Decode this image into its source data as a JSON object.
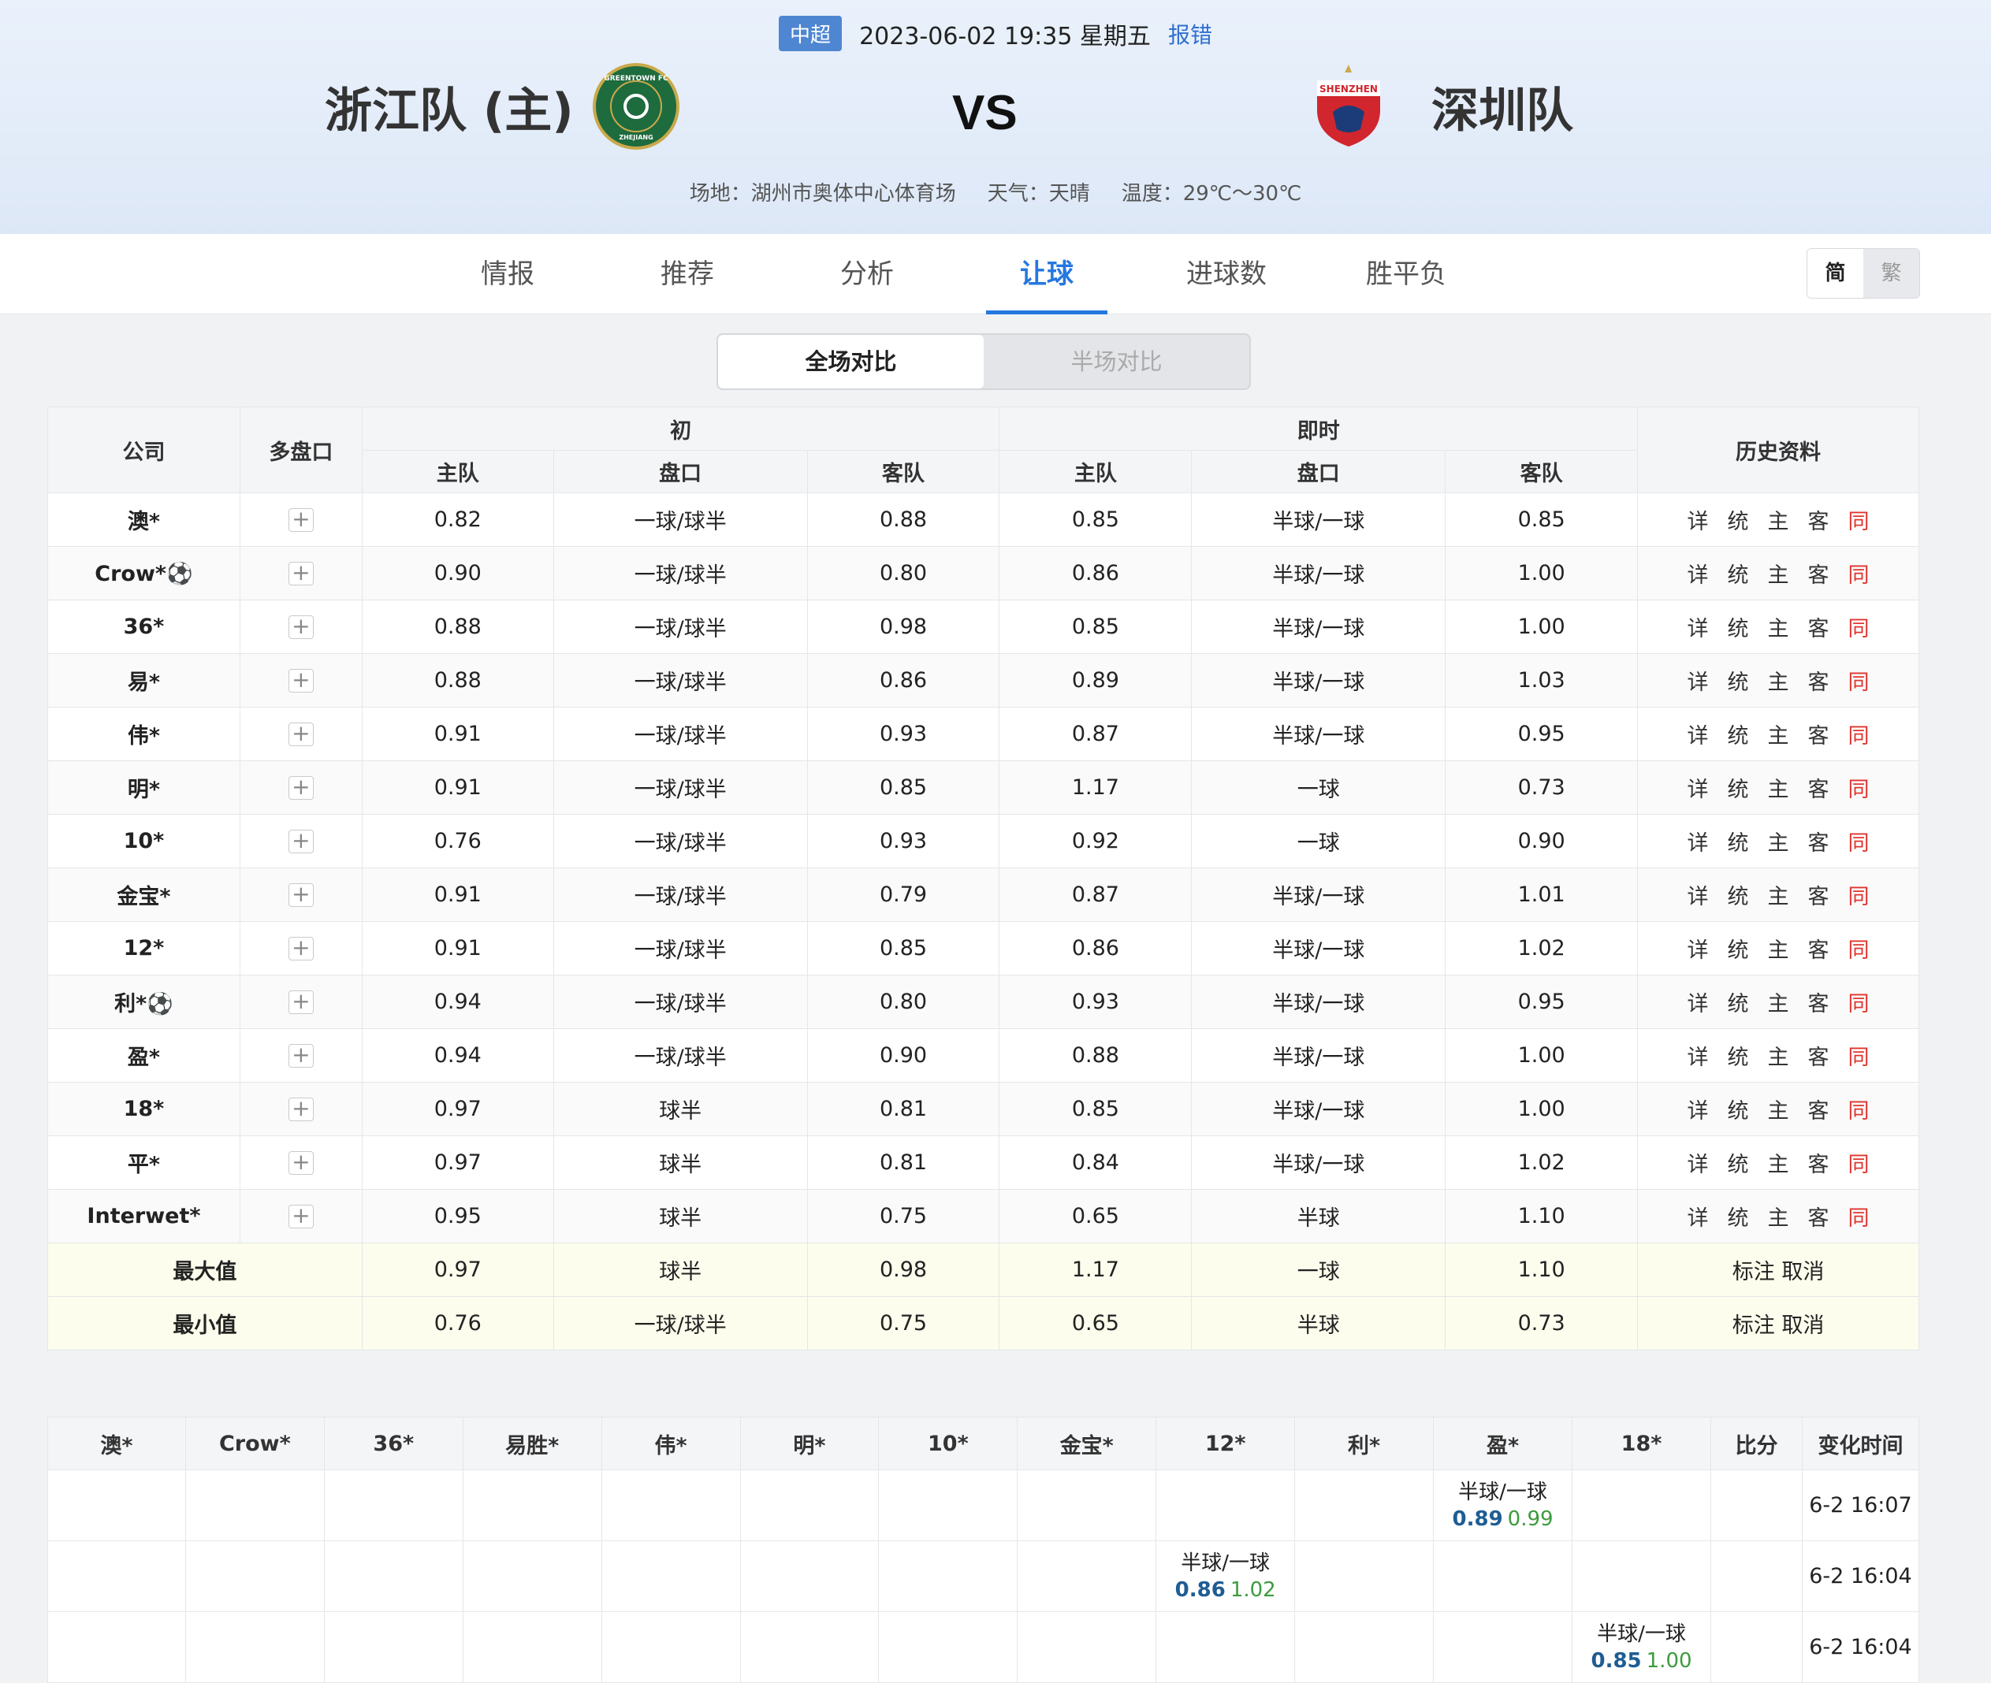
{
  "match": {
    "league": "中超",
    "datetime": "2023-06-02 19:35 星期五",
    "report": "报错",
    "home_team": "浙江队 (主)",
    "away_team": "深圳队",
    "vs": "VS",
    "venue": "场地：湖州市奥体中心体育场",
    "weather": "天气：天晴",
    "temperature": "温度：29℃～30℃",
    "home_crest_text": "GREENTOWN FC",
    "home_crest_sub": "ZHEJIANG",
    "away_crest_text": "SHENZHEN"
  },
  "nav": {
    "tabs": [
      "情报",
      "推荐",
      "分析",
      "让球",
      "进球数",
      "胜平负"
    ],
    "active": "让球",
    "lang_simplified": "简",
    "lang_traditional": "繁"
  },
  "segment": {
    "full": "全场对比",
    "half": "半场对比"
  },
  "odds_table": {
    "headers": {
      "company": "公司",
      "multi": "多盘口",
      "initial": "初",
      "live": "即时",
      "history": "历史资料",
      "home": "主队",
      "line": "盘口",
      "away": "客队"
    },
    "plus": "+",
    "history_links": [
      "详",
      "统",
      "主",
      "客",
      "同"
    ],
    "rows": [
      {
        "company": "澳*",
        "i_home": "0.82",
        "i_line": "一球/球半",
        "i_away": "0.88",
        "l_home": "0.85",
        "l_line": "半球/一球",
        "l_away": "0.85"
      },
      {
        "company": "Crow*⚽",
        "i_home": "0.90",
        "i_line": "一球/球半",
        "i_away": "0.80",
        "l_home": "0.86",
        "l_line": "半球/一球",
        "l_away": "1.00"
      },
      {
        "company": "36*",
        "i_home": "0.88",
        "i_line": "一球/球半",
        "i_away": "0.98",
        "l_home": "0.85",
        "l_line": "半球/一球",
        "l_away": "1.00"
      },
      {
        "company": "易*",
        "i_home": "0.88",
        "i_line": "一球/球半",
        "i_away": "0.86",
        "l_home": "0.89",
        "l_line": "半球/一球",
        "l_away": "1.03"
      },
      {
        "company": "伟*",
        "i_home": "0.91",
        "i_line": "一球/球半",
        "i_away": "0.93",
        "l_home": "0.87",
        "l_line": "半球/一球",
        "l_away": "0.95"
      },
      {
        "company": "明*",
        "i_home": "0.91",
        "i_line": "一球/球半",
        "i_away": "0.85",
        "l_home": "1.17",
        "l_line": "一球",
        "l_away": "0.73"
      },
      {
        "company": "10*",
        "i_home": "0.76",
        "i_line": "一球/球半",
        "i_away": "0.93",
        "l_home": "0.92",
        "l_line": "一球",
        "l_away": "0.90"
      },
      {
        "company": "金宝*",
        "i_home": "0.91",
        "i_line": "一球/球半",
        "i_away": "0.79",
        "l_home": "0.87",
        "l_line": "半球/一球",
        "l_away": "1.01"
      },
      {
        "company": "12*",
        "i_home": "0.91",
        "i_line": "一球/球半",
        "i_away": "0.85",
        "l_home": "0.86",
        "l_line": "半球/一球",
        "l_away": "1.02"
      },
      {
        "company": "利*⚽",
        "i_home": "0.94",
        "i_line": "一球/球半",
        "i_away": "0.80",
        "l_home": "0.93",
        "l_line": "半球/一球",
        "l_away": "0.95"
      },
      {
        "company": "盈*",
        "i_home": "0.94",
        "i_line": "一球/球半",
        "i_away": "0.90",
        "l_home": "0.88",
        "l_line": "半球/一球",
        "l_away": "1.00"
      },
      {
        "company": "18*",
        "i_home": "0.97",
        "i_line": "球半",
        "i_away": "0.81",
        "l_home": "0.85",
        "l_line": "半球/一球",
        "l_away": "1.00"
      },
      {
        "company": "平*",
        "i_home": "0.97",
        "i_line": "球半",
        "i_away": "0.81",
        "l_home": "0.84",
        "l_line": "半球/一球",
        "l_away": "1.02"
      },
      {
        "company": "Interwet*",
        "i_home": "0.95",
        "i_line": "球半",
        "i_away": "0.75",
        "l_home": "0.65",
        "l_line": "半球",
        "l_away": "1.10"
      }
    ],
    "summary": [
      {
        "label": "最大值",
        "i_home": "0.97",
        "i_line": "球半",
        "i_away": "0.98",
        "l_home": "1.17",
        "l_line": "一球",
        "l_away": "1.10",
        "action": "标注 取消"
      },
      {
        "label": "最小值",
        "i_home": "0.76",
        "i_line": "一球/球半",
        "i_away": "0.75",
        "l_home": "0.65",
        "l_line": "半球",
        "l_away": "0.73",
        "action": "标注 取消"
      }
    ]
  },
  "changes_table": {
    "headers": [
      "澳*",
      "Crow*",
      "36*",
      "易胜*",
      "伟*",
      "明*",
      "10*",
      "金宝*",
      "12*",
      "利*",
      "盈*",
      "18*",
      "比分",
      "变化时间"
    ],
    "rows": [
      {
        "col": 10,
        "line": "半球/一球",
        "home": "0.89",
        "away": "0.99",
        "time": "6-2 16:07"
      },
      {
        "col": 8,
        "line": "半球/一球",
        "home": "0.86",
        "away": "1.02",
        "time": "6-2 16:04"
      },
      {
        "col": 11,
        "line": "半球/一球",
        "home": "0.85",
        "away": "1.00",
        "time": "6-2 16:04"
      }
    ]
  },
  "colors": {
    "accent": "#2577e0",
    "league_badge": "#4f86d1",
    "history_same": "#e0342e",
    "summary_bg": "#fcfdec",
    "home_odds": "#1f5d93",
    "away_odds": "#3d9b3d"
  }
}
